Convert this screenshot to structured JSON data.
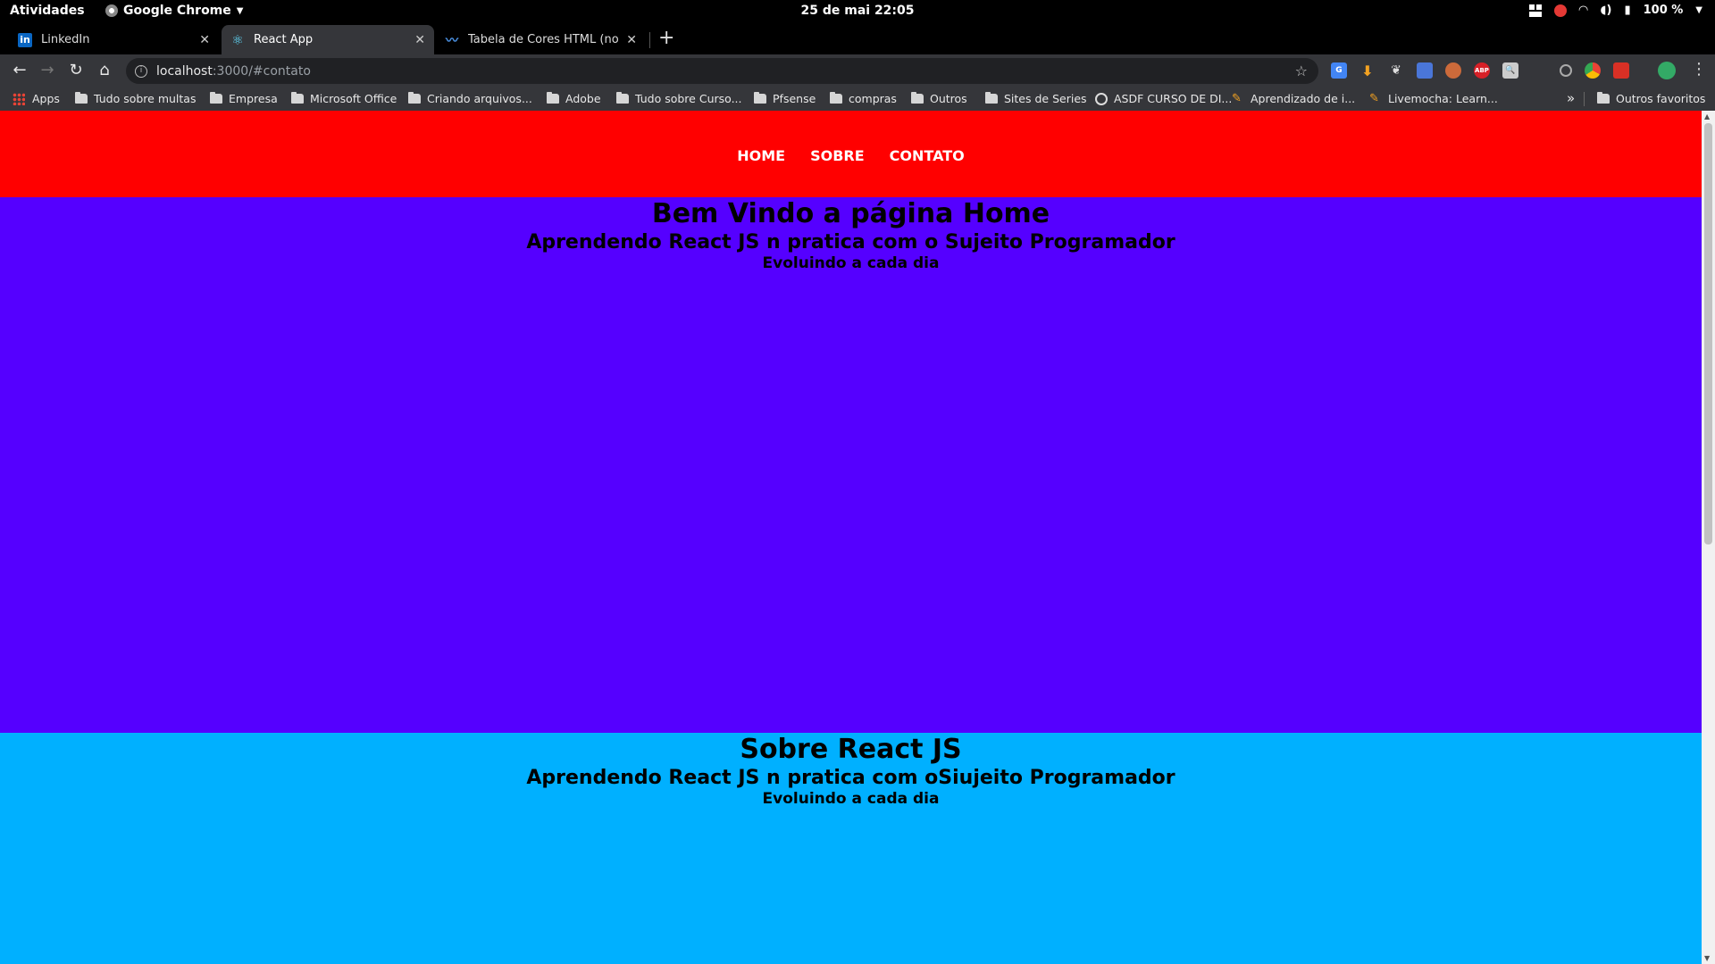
{
  "topbar": {
    "activities": "Atividades",
    "app_name": "Google Chrome",
    "clock": "25 de mai  22:05",
    "battery": "100 %"
  },
  "tabs": [
    {
      "title": "LinkedIn",
      "favicon": "in",
      "active": false
    },
    {
      "title": "React App",
      "favicon": "react-icon",
      "active": true
    },
    {
      "title": "Tabela de Cores HTML (nome,",
      "favicon": "wave-icon",
      "active": false
    }
  ],
  "omnibox": {
    "host": "localhost",
    "path": ":3000/#contato"
  },
  "bookmarks": [
    {
      "label": "Apps",
      "icon": "apps-grid-icon"
    },
    {
      "label": "Tudo sobre multas",
      "icon": "folder-icon"
    },
    {
      "label": "Empresa",
      "icon": "folder-icon"
    },
    {
      "label": "Microsoft Office",
      "icon": "folder-icon"
    },
    {
      "label": "Criando arquivos...",
      "icon": "folder-icon"
    },
    {
      "label": "Adobe",
      "icon": "folder-icon"
    },
    {
      "label": "Tudo sobre Curso...",
      "icon": "folder-icon"
    },
    {
      "label": "Pfsense",
      "icon": "folder-icon"
    },
    {
      "label": "compras",
      "icon": "folder-icon"
    },
    {
      "label": "Outros",
      "icon": "folder-icon"
    },
    {
      "label": "Sites de Series",
      "icon": "folder-icon"
    },
    {
      "label": "ASDF CURSO DE DI...",
      "icon": "globe-icon"
    },
    {
      "label": "Aprendizado de i...",
      "icon": "livemocha-icon"
    },
    {
      "label": "Livemocha: Learn...",
      "icon": "livemocha-icon"
    }
  ],
  "bookmarks_more": "»",
  "other_bookmarks": "Outros favoritos",
  "page": {
    "nav": [
      "HOME",
      "SOBRE",
      "CONTATO"
    ],
    "home": {
      "title": "Bem Vindo a página Home",
      "subtitle": "Aprendendo React JS n pratica com o Sujeito Programador",
      "tagline": "Evoluindo a cada dia",
      "bg": "#5500ff"
    },
    "sobre": {
      "title": "Sobre React JS",
      "subtitle": "Aprendendo React JS n pratica com oSiujeito Programador",
      "tagline": "Evoluindo a cada dia",
      "bg": "#00b0ff"
    },
    "header_bg": "#ff0000"
  }
}
